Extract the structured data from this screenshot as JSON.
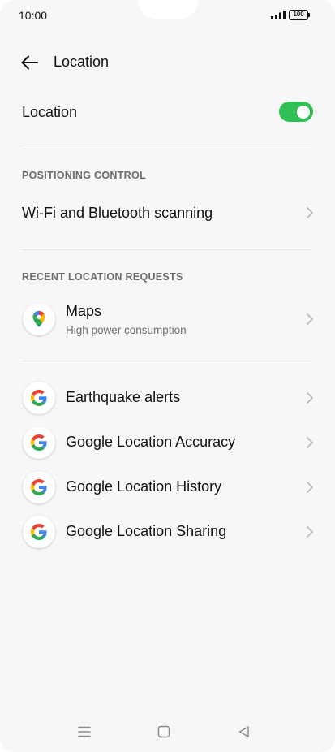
{
  "status": {
    "time": "10:00",
    "battery": "100"
  },
  "header": {
    "title": "Location"
  },
  "location_row": {
    "label": "Location",
    "enabled": true
  },
  "sections": {
    "positioning": "POSITIONING CONTROL",
    "recent": "RECENT LOCATION REQUESTS"
  },
  "positioning_items": [
    {
      "label": "Wi-Fi and Bluetooth scanning"
    }
  ],
  "recent_requests": [
    {
      "name": "Maps",
      "detail": "High power consumption",
      "icon": "maps-icon"
    }
  ],
  "services": [
    {
      "name": "Earthquake alerts",
      "icon": "google-icon"
    },
    {
      "name": "Google Location Accuracy",
      "icon": "google-icon"
    },
    {
      "name": "Google Location History",
      "icon": "google-icon"
    },
    {
      "name": "Google Location Sharing",
      "icon": "google-icon"
    }
  ],
  "colors": {
    "toggle_on": "#2fbf55",
    "background": "#f7f7f7",
    "divider": "#e3e3e3"
  },
  "nav": [
    "menu-icon",
    "home-icon",
    "back-triangle-icon"
  ]
}
